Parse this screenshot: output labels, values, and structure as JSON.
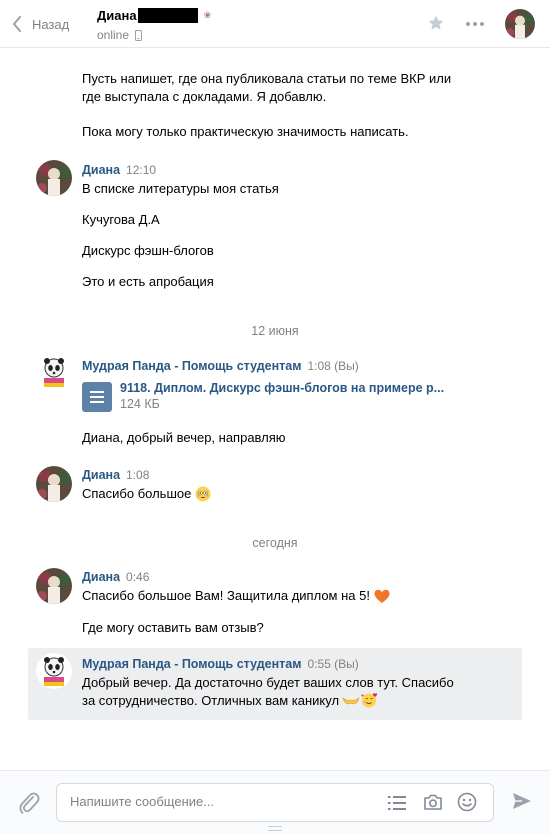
{
  "header": {
    "back_label": "Назад",
    "peer_name": "Диана",
    "peer_status": "online"
  },
  "messages": {
    "partial_top": "Пусть напишет, где она публиковала статьи по теме ВКР или\nгде выступала с докладами. Я добавлю.",
    "partial_top_2": "Пока могу только практическую значимость написать.",
    "m1_name": "Диана",
    "m1_time": "12:10",
    "m1_l1": "В списке литературы моя статья",
    "m1_l2": "Кучугова Д.А",
    "m1_l3": "Дискурс фэшн-блогов",
    "m1_l4": "Это и есть апробация",
    "date1": "12 июня",
    "m2_name": "Мудрая Панда - Помощь студентам",
    "m2_time": "1:08 (Вы)",
    "m2_doc_name": "9118. Диплом. Дискурс фэшн-блогов на примере р...",
    "m2_doc_size": "124 КБ",
    "m2_text": "Диана, добрый вечер, направляю",
    "m3_name": "Диана",
    "m3_time": "1:08",
    "m3_text": "Спасибо большое",
    "date2": "сегодня",
    "m4_name": "Диана",
    "m4_time": "0:46",
    "m4_l1": "Спасибо большое Вам! Защитила диплом на 5!",
    "m4_l2": "Где могу оставить вам отзыв?",
    "m5_name": "Мудрая Панда - Помощь студентам",
    "m5_time": "0:55 (Вы)",
    "m5_text": "Добрый вечер. Да достаточно будет ваших слов тут. Спасибо\nза сотрудничество. Отличных вам каникул"
  },
  "composer": {
    "placeholder": "Напишите сообщение..."
  },
  "colors": {
    "link": "#2a5885",
    "muted": "#828282",
    "highlight": "#edeef0",
    "doc_icon": "#5e81a8"
  },
  "icons": [
    "back-chevron-icon",
    "phone-icon",
    "star-icon",
    "more-icon",
    "document-icon",
    "flushed-emoji-icon",
    "heart-emoji-icon",
    "hands-emoji-icon",
    "smiling-hearts-emoji-icon",
    "paperclip-icon",
    "list-icon",
    "camera-icon",
    "smile-icon",
    "send-icon"
  ]
}
